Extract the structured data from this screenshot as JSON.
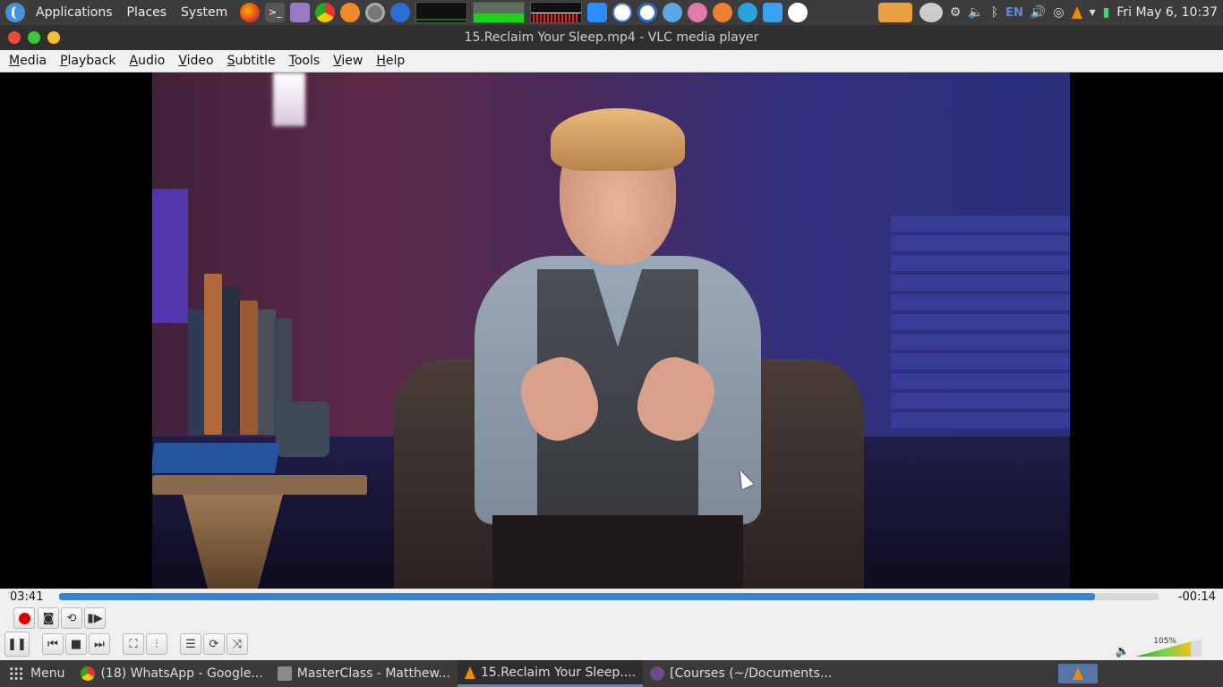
{
  "top_panel": {
    "menus": [
      "Applications",
      "Places",
      "System"
    ],
    "language": "EN",
    "clock": "Fri May  6, 10:37"
  },
  "window": {
    "title": "15.Reclaim Your Sleep.mp4 - VLC media player"
  },
  "menubar": {
    "items": [
      "Media",
      "Playback",
      "Audio",
      "Video",
      "Subtitle",
      "Tools",
      "View",
      "Help"
    ]
  },
  "player": {
    "elapsed": "03:41",
    "remaining": "-00:14",
    "progress": 0.942,
    "volume_label": "105%",
    "volume": 1.05
  },
  "taskbar": {
    "menu_label": "Menu",
    "tasks": [
      {
        "label": "(18) WhatsApp - Google...",
        "icon": "chrome-icon"
      },
      {
        "label": "MasterClass - Matthew...",
        "icon": "folder-icon"
      },
      {
        "label": "15.Reclaim Your Sleep....",
        "icon": "vlc-icon"
      },
      {
        "label": "[Courses (~/Documents...",
        "icon": "editor-icon"
      }
    ]
  },
  "colors": {
    "accent": "#3583d6",
    "record": "#e10000"
  }
}
